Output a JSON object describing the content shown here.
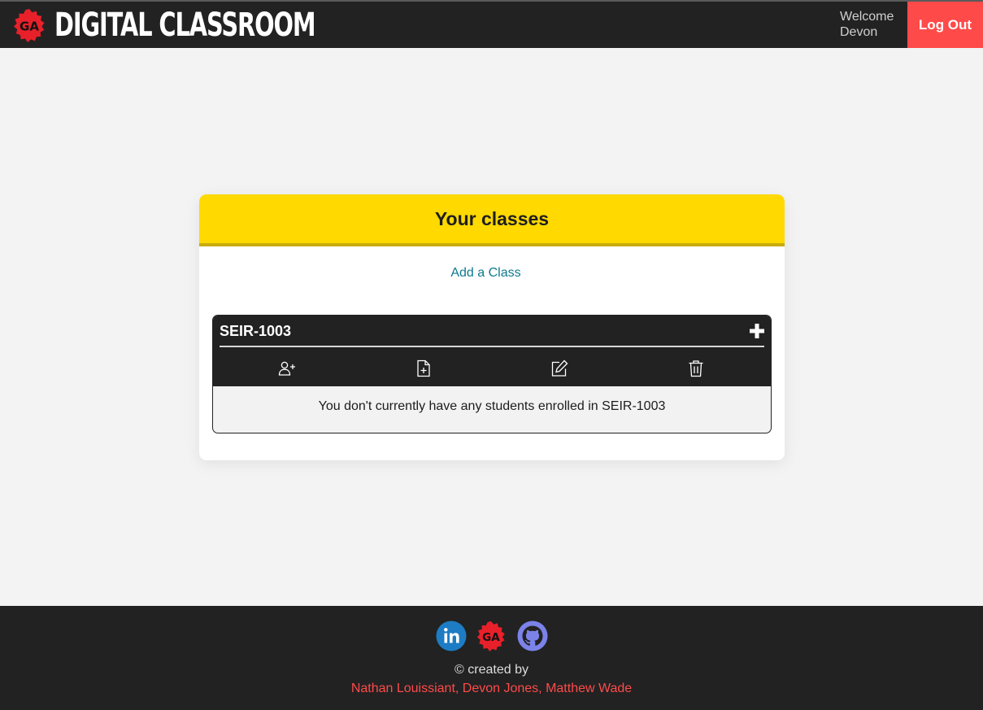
{
  "header": {
    "logo_text": "GA",
    "title": "DIGITAL CLASSROOM",
    "welcome_line1": "Welcome",
    "welcome_line2": "Devon",
    "logout_label": "Log Out"
  },
  "colors": {
    "topbar": "#222222",
    "accent_red": "#ff4a4a",
    "panel_header_yellow": "#ffd900",
    "link_teal": "#0e7a8f",
    "github_purple": "#7b83e8",
    "linkedin_blue": "#1d7cc3"
  },
  "panel": {
    "title": "Your classes",
    "add_class_label": "Add a Class",
    "classes": [
      {
        "name": "SEIR-1003",
        "actions": [
          "add-student-icon",
          "add-document-icon",
          "edit-icon",
          "trash-icon"
        ],
        "empty_message": "You don't currently have any students enrolled in SEIR-1003"
      }
    ]
  },
  "footer": {
    "icons": [
      "linkedin-icon",
      "ga-logo-icon",
      "github-icon"
    ],
    "ga_logo_text": "GA",
    "created_by": "© created by",
    "authors": "Nathan Louissiant, Devon Jones, Matthew Wade"
  }
}
